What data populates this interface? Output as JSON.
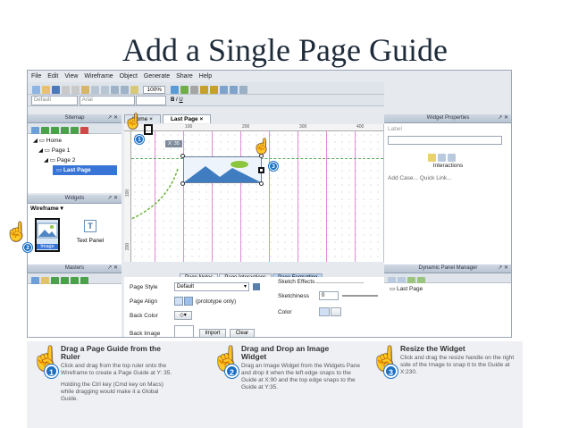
{
  "slide_title": "Add a Single Page Guide",
  "menu": [
    "File",
    "Edit",
    "View",
    "Wireframe",
    "Object",
    "Generate",
    "Share",
    "Help"
  ],
  "toolbar": {
    "zoom": "100%",
    "style_default": "Default",
    "font": "Arial"
  },
  "sitemap": {
    "header": "Sitemap",
    "pin": "↗ ✕",
    "items": [
      {
        "label": "Home",
        "level": 0
      },
      {
        "label": "Page 1",
        "level": 1
      },
      {
        "label": "Page 2",
        "level": 2
      },
      {
        "label": "Last Page",
        "level": 3,
        "selected": true
      }
    ]
  },
  "widgets": {
    "header": "Widgets",
    "pin": "↗ ✕",
    "library": "Wireframe",
    "items": [
      "Image",
      "Text Panel"
    ]
  },
  "masters": {
    "header": "Masters",
    "pin": "↗ ✕"
  },
  "tabs": {
    "home": "Home",
    "close": "×",
    "active": "Last Page"
  },
  "ruler": {
    "marks": [
      "100",
      "200",
      "300",
      "400"
    ],
    "vmarks": [
      "100",
      "200"
    ]
  },
  "canvas": {
    "tooltip": "X: 35"
  },
  "bottom": {
    "tabs": [
      "Page Notes",
      "Page Interactions",
      "Page Formatting"
    ],
    "page_style_label": "Page Style",
    "page_style_value": "Default",
    "page_align_label": "Page Align",
    "page_align_note": "(prototype only)",
    "back_color_label": "Back Color",
    "back_image_label": "Back Image",
    "import_label": "Import",
    "clear_label": "Clear",
    "sketch_effects_label": "Sketch Effects",
    "sketchiness_label": "Sketchiness",
    "sketchiness_value": "0",
    "color_label": "Color"
  },
  "widget_properties": {
    "header": "Widget Properties",
    "label": "Label",
    "interactions": "Interactions",
    "add_case": "Add Case...",
    "quick_link": "Quick Link..."
  },
  "dynamic_panel": {
    "header": "Dynamic Panel Manager",
    "item": "Last Page"
  },
  "steps": [
    {
      "n": "1",
      "title": "Drag a Page Guide from the Ruler",
      "body": "Click and drag from the top ruler onto the Wireframe to create a Page Guide at Y: 35.",
      "note": "Holding the Ctrl key (Cmd key on Macs) while dragging would make it a Global Guide."
    },
    {
      "n": "2",
      "title": "Drag and Drop an Image Widget",
      "body": "Drag an Image Widget from the Widgets Pane and drop it when the left edge snaps to the Guide at X:90 and the top edge snaps to the Guide at Y:35."
    },
    {
      "n": "3",
      "title": "Resize the Widget",
      "body": "Click and drag the resize handle on the right side of the Image to snap it to the Guide at X:230."
    }
  ],
  "callouts": [
    "1",
    "2",
    "3"
  ]
}
